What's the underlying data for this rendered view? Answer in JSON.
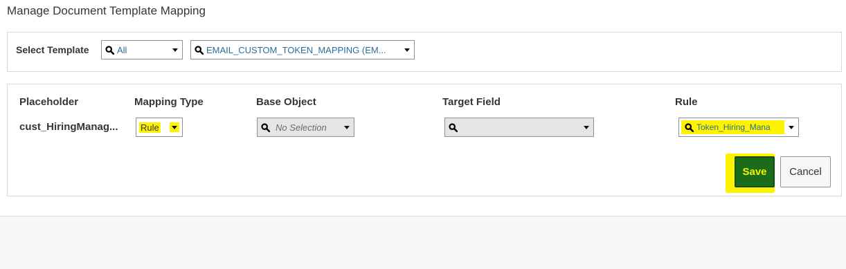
{
  "page": {
    "title": "Manage Document Template Mapping"
  },
  "template_selection": {
    "label": "Select Template",
    "category": {
      "value": "All",
      "icon": "search-icon"
    },
    "template": {
      "value": "EMAIL_CUSTOM_TOKEN_MAPPING (EM...",
      "icon": "search-icon"
    }
  },
  "mapping": {
    "columns": [
      "Placeholder",
      "Mapping Type",
      "Base Object",
      "Target Field",
      "Rule"
    ],
    "row": {
      "placeholder": "cust_HiringManag...",
      "mapping_type": "Rule",
      "base_object": "No Selection",
      "target_field": "",
      "rule": "Token_Hiring_Mana"
    }
  },
  "actions": {
    "save_label": "Save",
    "cancel_label": "Cancel"
  },
  "colors": {
    "highlight": "#fff200",
    "save_button": "#1a6b1a",
    "link_text": "#2c6c9c"
  }
}
